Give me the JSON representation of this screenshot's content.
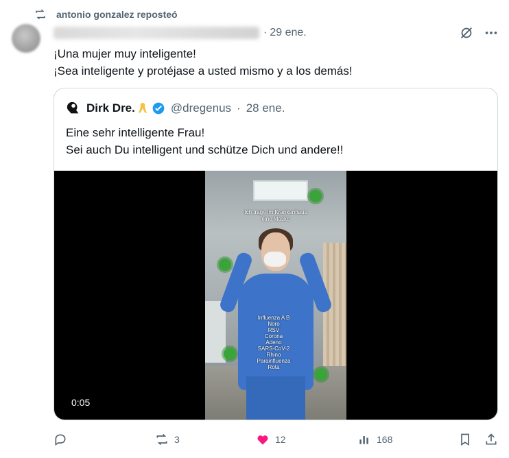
{
  "repost": {
    "label": "antonio gonzalez reposteó"
  },
  "tweet": {
    "time": "29 ene.",
    "lines": [
      "¡Una mujer muy inteligente!",
      "¡Sea inteligente y protéjase a usted mismo y a los demás!"
    ]
  },
  "quote": {
    "name": "Dirk Dre.",
    "handle": "@dregenus",
    "time": "28 ene.",
    "lines": [
      "Eine sehr intelligente Frau!",
      "Sei auch Du intelligent und schütze Dich und andere!!"
    ],
    "video": {
      "caption_top": [
        "Ich trage im Krankenhaus",
        "eine Maske"
      ],
      "overlay_list": [
        "Influenza A   B",
        "Noro",
        "RSV",
        "Corona",
        "Adeno",
        "SARS-CoV-2",
        "Rhino",
        "Parainfluenza",
        "Rota"
      ],
      "duration": "0:05"
    }
  },
  "actions": {
    "reply_count": "",
    "repost_count": "3",
    "like_count": "12",
    "views_count": "168"
  },
  "colors": {
    "muted": "#536471",
    "like": "#f91880",
    "verified": "#1d9bf0",
    "ribbon": "#f5c242"
  },
  "icons": [
    "repost-icon",
    "grok-slash-icon",
    "more-icon",
    "verified-icon",
    "ribbon-icon",
    "reply-icon",
    "like-icon",
    "views-icon",
    "bookmark-icon",
    "share-icon"
  ]
}
